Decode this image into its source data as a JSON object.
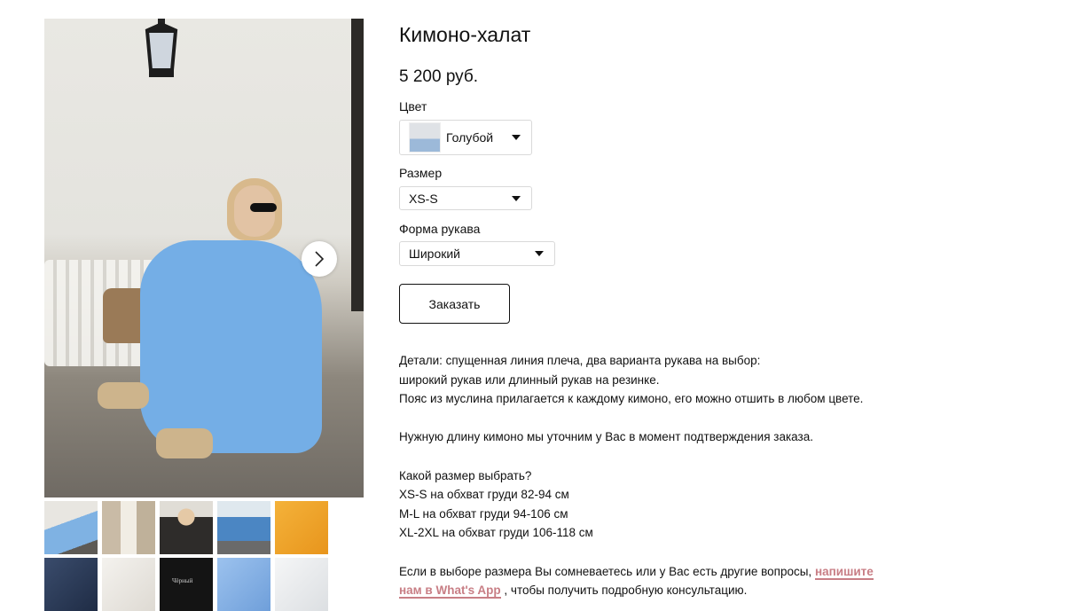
{
  "gallery": {
    "main_image_alt": "Кимоно-халат",
    "thumbnails": [
      {
        "tone": "#9cb7d4",
        "label": ""
      },
      {
        "tone": "#c9bfae",
        "label": ""
      },
      {
        "tone": "#3a3836",
        "label": ""
      },
      {
        "tone": "#7aa6c9",
        "label": ""
      },
      {
        "tone": "#f0a42a",
        "label": ""
      },
      {
        "tone": "#2f3f5c",
        "label": ""
      },
      {
        "tone": "#ece9e4",
        "label": ""
      },
      {
        "tone": "#141414",
        "label": "Чёрный"
      },
      {
        "tone": "#8ab4e6",
        "label": ""
      },
      {
        "tone": "#eef0f1",
        "label": ""
      }
    ]
  },
  "product": {
    "title": "Кимоно-халат",
    "price": "5 200 руб."
  },
  "options": {
    "color_label": "Цвет",
    "color_value": "Голубой",
    "size_label": "Размер",
    "size_value": "XS-S",
    "sleeve_label": "Форма рукава",
    "sleeve_value": "Широкий"
  },
  "order_button": "Заказать",
  "description": {
    "line1": "Детали: спущенная линия плеча, два варианта рукава на выбор:",
    "line2": "широкий рукав или длинный рукав на резинке.",
    "line3": "Пояс из муслина прилагается к каждому кимоно, его можно отшить в любом цвете.",
    "line4": "Нужную длину кимоно мы уточним у Вас в момент подтверждения заказа.",
    "line5": "Какой размер выбрать?",
    "line6": "XS-S на обхват груди 82-94 см",
    "line7": "M-L на обхват груди 94-106 см",
    "line8": "XL-2XL на обхват груди 106-118 см",
    "line9_a": "Если в выборе размера Вы сомневаетесь или у Вас есть другие вопросы,",
    "line9_link": "напишите",
    "line10_link": "нам в What's App",
    "line10_b": ", чтобы получить подробную консультацию."
  },
  "colors": {
    "accent_link": "#c87e85",
    "dress": "#74aee6"
  }
}
